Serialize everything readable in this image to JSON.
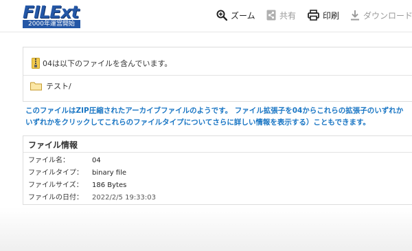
{
  "header": {
    "logo": {
      "main": "FILExt",
      "sub": "2000年運営開始"
    },
    "toolbar": {
      "zoom_label": "ズーム",
      "share_label": "共有",
      "print_label": "印刷",
      "download_label": "ダウンロード..."
    },
    "icons": {
      "zoom": "magnifier-plus-icon",
      "share": "share-icon",
      "print": "printer-icon",
      "download": "download-icon"
    }
  },
  "archive": {
    "heading": "04は以下のファイルを含んでいます。",
    "items": [
      {
        "name": "テスト/",
        "icon": "folder-icon"
      }
    ]
  },
  "description": {
    "line1": "このファイルはZIP圧縮されたアーカイブファイルのようです。 ファイル拡張子を04からこれらの拡張子のいずれか",
    "line2": "いずれかをクリックしてこれらのファイルタイプについてさらに詳しい情報を表示する）こともできます。"
  },
  "file_info": {
    "title": "ファイル情報",
    "rows": [
      {
        "label": "ファイル名：",
        "value": "04"
      },
      {
        "label": "ファイルタイプ：",
        "value": "binary file"
      },
      {
        "label": "ファイルサイズ：",
        "value": "186 Bytes"
      },
      {
        "label": "ファイルの日付：",
        "value": "2022/2/5 19:33:03"
      }
    ]
  },
  "colors": {
    "brand": "#2457a6",
    "link_text": "#1a76c4",
    "disabled": "#9a9a9a",
    "border": "#dddddd"
  }
}
